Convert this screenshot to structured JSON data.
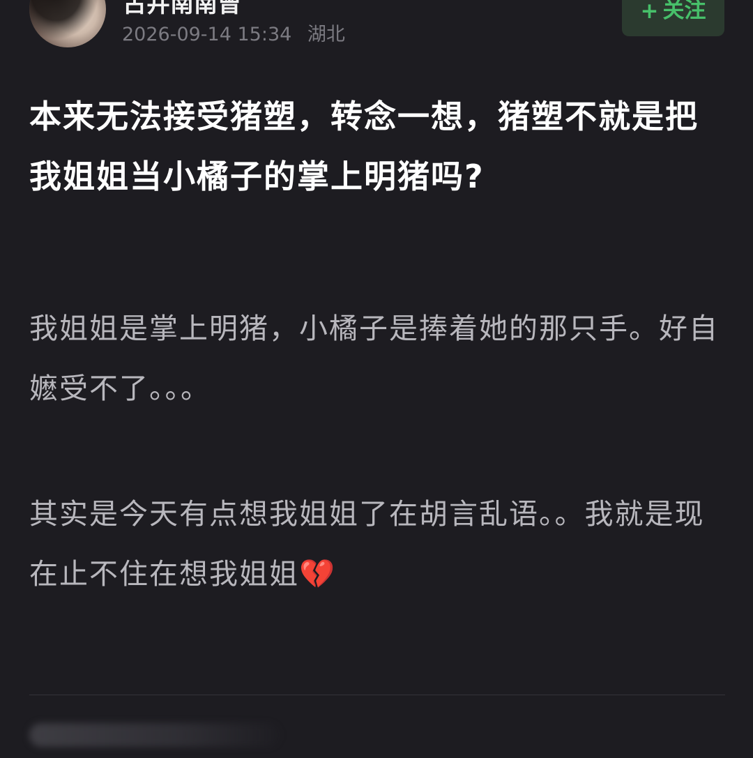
{
  "post": {
    "author_name": "古井南南曾",
    "date": "2026-09-14 15:34",
    "location": "湖北",
    "follow_plus": "+",
    "follow_label": "关注",
    "title": "本来无法接受猪塑，转念一想，猪塑不就是把我姐姐当小橘子的掌上明猪吗?",
    "paragraph_1": "我姐姐是掌上明猪，小橘子是捧着她的那只手。好自嬷受不了。。。",
    "paragraph_2": "其实是今天有点想我姐姐了在胡言乱语。。我就是现在止不住在想我姐姐💔"
  },
  "colors": {
    "background": "#1d1c21",
    "title_text": "#ffffff",
    "body_text": "#b8b7bd",
    "meta_text": "#7c7b82",
    "follow_text": "#47c06a",
    "follow_bg": "#2b3a2f"
  },
  "icons": {
    "broken_heart": "broken-heart-emoji"
  }
}
